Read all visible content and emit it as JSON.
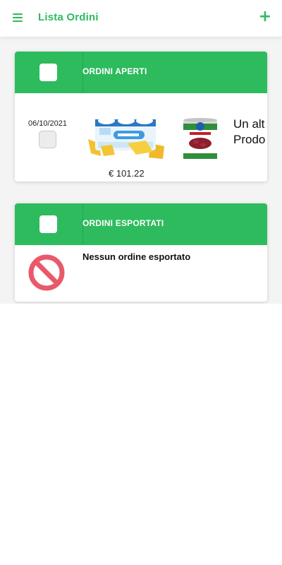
{
  "header": {
    "title": "Lista Ordini",
    "menu_icon": "hamburger-menu-icon",
    "add_icon": "plus-icon",
    "accent_color": "#2dbb5d"
  },
  "open_orders": {
    "title": "ORDINI APERTI",
    "header_color": "#2dbb5d",
    "orders": [
      {
        "date": "06/10/2021",
        "price": "€ 101.22",
        "text_lines": [
          "Un alt",
          "Prodo"
        ],
        "product_images": [
          "yogurt-pack-image",
          "kidney-beans-can-image"
        ]
      }
    ]
  },
  "exported_orders": {
    "title": "ORDINI ESPORTATI",
    "empty_message": "Nessun ordine esportato",
    "empty_icon": "no-entry-icon",
    "empty_icon_color": "#e9596a"
  }
}
